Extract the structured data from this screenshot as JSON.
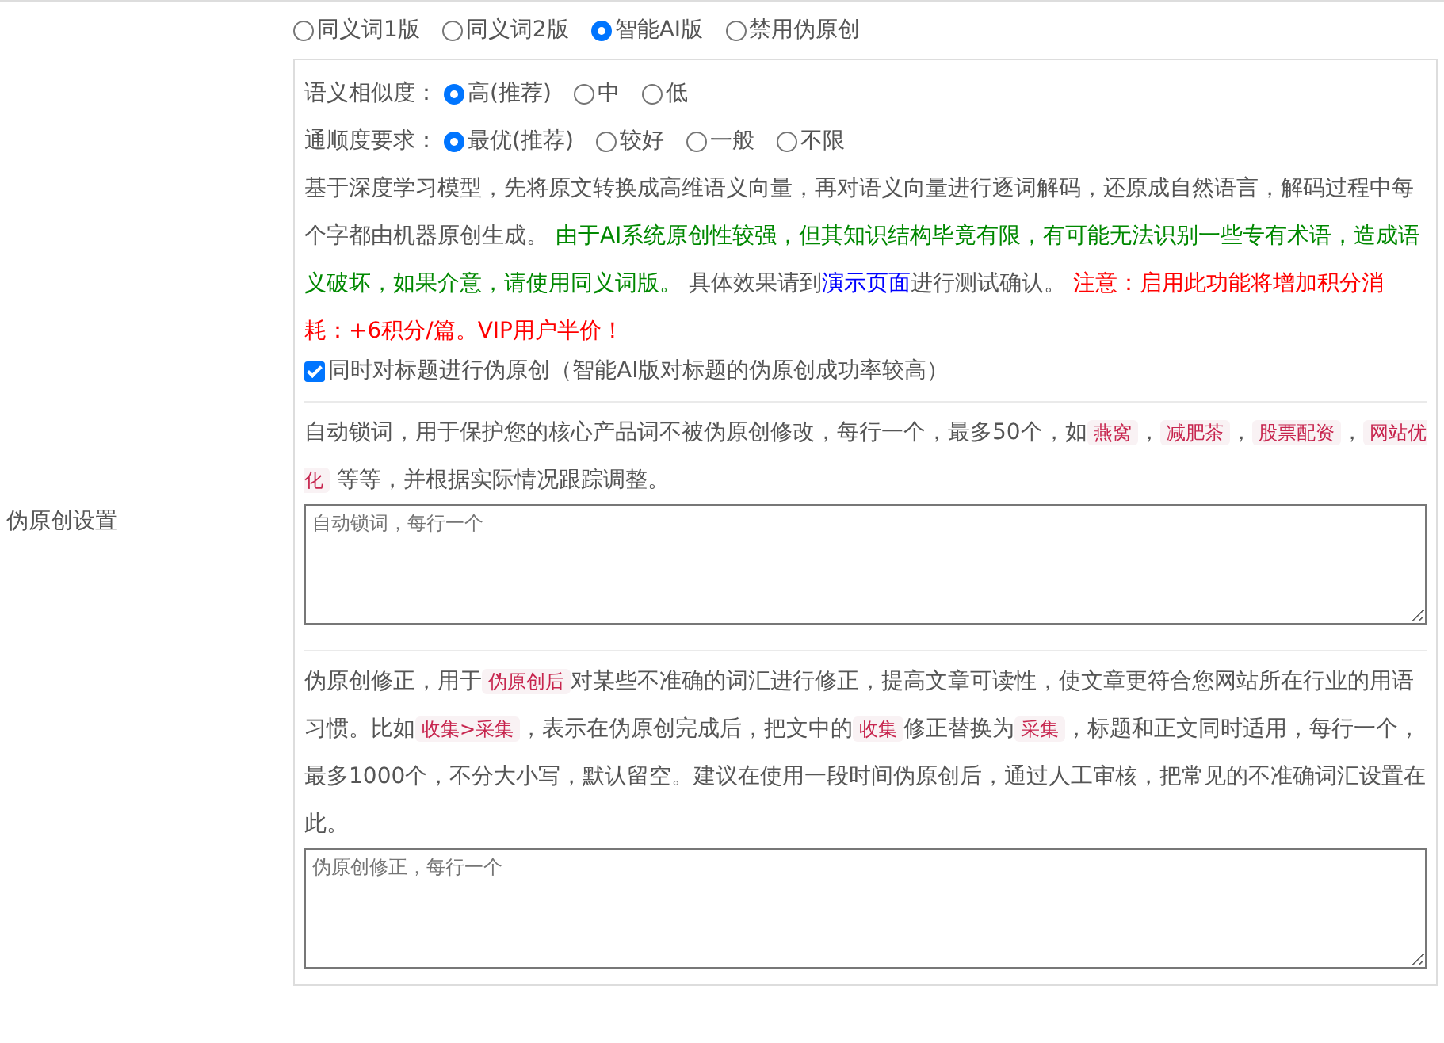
{
  "side_label": "伪原创设置",
  "modes": [
    {
      "label": "同义词1版",
      "selected": false
    },
    {
      "label": "同义词2版",
      "selected": false
    },
    {
      "label": "智能AI版",
      "selected": true
    },
    {
      "label": "禁用伪原创",
      "selected": false
    }
  ],
  "similarity": {
    "label": "语义相似度：",
    "options": [
      {
        "label": "高(推荐)",
        "selected": true
      },
      {
        "label": "中",
        "selected": false
      },
      {
        "label": "低",
        "selected": false
      }
    ]
  },
  "fluency": {
    "label": "通顺度要求：",
    "options": [
      {
        "label": "最优(推荐)",
        "selected": true
      },
      {
        "label": "较好",
        "selected": false
      },
      {
        "label": "一般",
        "selected": false
      },
      {
        "label": "不限",
        "selected": false
      }
    ]
  },
  "description": [
    {
      "kind": "text",
      "text": "基于深度学习模型，先将原文转换成高维语义向量，再对语义向量进行逐词解码，还原成自然语言，解码过程中每个字都由机器原创生成。 "
    },
    {
      "kind": "warning",
      "text": "由于AI系统原创性较强，但其知识结构毕竟有限，有可能无法识别一些专有术语，造成语义破坏，如果介意，请使用同义词版。"
    },
    {
      "kind": "text",
      "text": " 具体效果请到"
    },
    {
      "kind": "link",
      "text": "演示页面"
    },
    {
      "kind": "text",
      "text": "进行测试确认。 "
    },
    {
      "kind": "alert",
      "text": "注意：启用此功能将增加积分消耗：+6积分/篇。VIP用户半价！"
    }
  ],
  "title_option": {
    "label": "同时对标题进行伪原创（智能AI版对标题的伪原创成功率较高）",
    "checked": true
  },
  "lock_words": {
    "description": [
      {
        "kind": "text",
        "text": "自动锁词，用于保护您的核心产品词不被伪原创修改，每行一个，最多50个，如"
      },
      {
        "kind": "code",
        "text": "燕窝"
      },
      {
        "kind": "text",
        "text": "，"
      },
      {
        "kind": "code",
        "text": "减肥茶"
      },
      {
        "kind": "text",
        "text": "，"
      },
      {
        "kind": "code",
        "text": "股票配资"
      },
      {
        "kind": "text",
        "text": "，"
      },
      {
        "kind": "code",
        "text": "网站优化"
      },
      {
        "kind": "text",
        "text": " 等等，并根据实际情况跟踪调整。"
      }
    ],
    "placeholder": "自动锁词，每行一个"
  },
  "correction": {
    "description": [
      {
        "kind": "text",
        "text": "伪原创修正，用于"
      },
      {
        "kind": "code",
        "text": "伪原创后"
      },
      {
        "kind": "text",
        "text": "对某些不准确的词汇进行修正，提高文章可读性，使文章更符合您网站所在行业的用语习惯。比如"
      },
      {
        "kind": "code",
        "text": "收集>采集"
      },
      {
        "kind": "text",
        "text": "，表示在伪原创完成后，把文中的"
      },
      {
        "kind": "code",
        "text": "收集"
      },
      {
        "kind": "text",
        "text": "修正替换为"
      },
      {
        "kind": "code",
        "text": "采集"
      },
      {
        "kind": "text",
        "text": "，标题和正文同时适用，每行一个，最多1000个，不分大小写，默认留空。建议在使用一段时间伪原创后，通过人工审核，把常见的不准确词汇设置在此。"
      }
    ],
    "placeholder": "伪原创修正，每行一个"
  }
}
